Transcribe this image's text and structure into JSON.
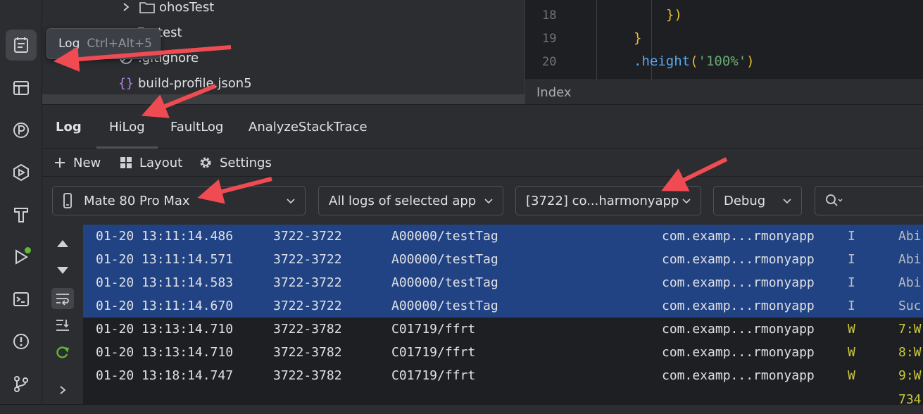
{
  "tooltip": {
    "name": "Log",
    "shortcut": "Ctrl+Alt+5"
  },
  "tree": {
    "items": [
      {
        "label": "ohosTest",
        "icon": "folder-icon"
      },
      {
        "label": "test",
        "icon": "folder-icon"
      },
      {
        "label": ".gitignore",
        "icon": "gitignore-icon"
      },
      {
        "label": "build-profile.json5",
        "icon": "json-icon"
      }
    ]
  },
  "editor": {
    "lines": [
      {
        "num": "18",
        "code": "})"
      },
      {
        "num": "19",
        "code": "}"
      },
      {
        "num": "20",
        "code": ".height",
        "paren_open": "(",
        "string": "'100%'",
        "paren_close": ")"
      }
    ],
    "breadcrumb": "Index"
  },
  "log_panel": {
    "tabs": [
      "Log",
      "HiLog",
      "FaultLog",
      "AnalyzeStackTrace"
    ],
    "toolbar": {
      "new": "New",
      "layout": "Layout",
      "settings": "Settings"
    },
    "filters": {
      "device": "Mate 80 Pro Max",
      "log_scope": "All logs of selected app",
      "process": "[3722] co...harmonyapp",
      "level": "Debug",
      "search_placeholder": ""
    },
    "rows": [
      {
        "time": "01-20 13:11:14.486",
        "pid": "3722-3722",
        "tag": "A00000/testTag",
        "pkg": "com.examp...rmonyapp",
        "level": "I",
        "msg": "Abi",
        "selected": true
      },
      {
        "time": "01-20 13:11:14.571",
        "pid": "3722-3722",
        "tag": "A00000/testTag",
        "pkg": "com.examp...rmonyapp",
        "level": "I",
        "msg": "Abi",
        "selected": true
      },
      {
        "time": "01-20 13:11:14.583",
        "pid": "3722-3722",
        "tag": "A00000/testTag",
        "pkg": "com.examp...rmonyapp",
        "level": "I",
        "msg": "Abi",
        "selected": true
      },
      {
        "time": "01-20 13:11:14.670",
        "pid": "3722-3722",
        "tag": "A00000/testTag",
        "pkg": "com.examp...rmonyapp",
        "level": "I",
        "msg": "Suc",
        "selected": true
      },
      {
        "time": "01-20 13:13:14.710",
        "pid": "3722-3782",
        "tag": "C01719/ffrt",
        "pkg": "com.examp...rmonyapp",
        "level": "W",
        "msg": "7:W",
        "selected": false
      },
      {
        "time": "01-20 13:13:14.710",
        "pid": "3722-3782",
        "tag": "C01719/ffrt",
        "pkg": "com.examp...rmonyapp",
        "level": "W",
        "msg": "8:W",
        "selected": false
      },
      {
        "time": "01-20 13:18:14.747",
        "pid": "3722-3782",
        "tag": "C01719/ffrt",
        "pkg": "com.examp...rmonyapp",
        "level": "W",
        "msg": "9:W",
        "selected": false
      }
    ],
    "overflow_text": "734"
  },
  "colors": {
    "selection": "#214283",
    "accent_arrow": "#f04a52",
    "warn": "#c9c93c",
    "active_dot": "#5fb832"
  }
}
